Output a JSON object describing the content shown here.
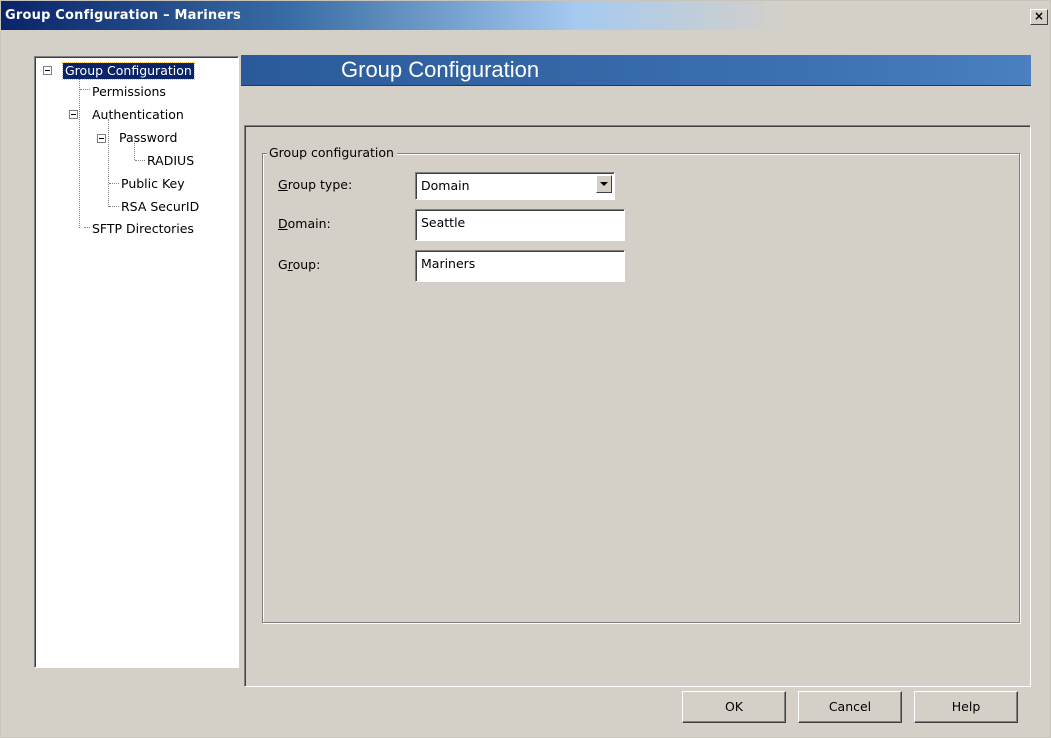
{
  "window": {
    "title": "Group Configuration – Mariners",
    "close_label": "×"
  },
  "tree": {
    "items": [
      {
        "label": "Group Configuration",
        "selected": true
      },
      {
        "label": "Permissions"
      },
      {
        "label": "Authentication"
      },
      {
        "label": "Password"
      },
      {
        "label": "RADIUS"
      },
      {
        "label": "Public Key"
      },
      {
        "label": "RSA SecurID"
      },
      {
        "label": "SFTP Directories"
      }
    ]
  },
  "header": {
    "title": "Group Configuration"
  },
  "groupbox": {
    "legend": "Group configuration"
  },
  "fields": {
    "group_type": {
      "label_first": "G",
      "label_rest": "roup type:",
      "value": "Domain"
    },
    "domain": {
      "label_first": "D",
      "label_rest": "omain:",
      "value": "Seattle"
    },
    "group": {
      "label_pre": "G",
      "label_ul": "r",
      "label_rest": "oup:",
      "value": "Mariners"
    }
  },
  "buttons": {
    "ok": "OK",
    "cancel": "Cancel",
    "help": "Help"
  },
  "colors": {
    "titlebar": "#0a246a",
    "header": "#3c70b0",
    "face": "#d4d0c8"
  }
}
